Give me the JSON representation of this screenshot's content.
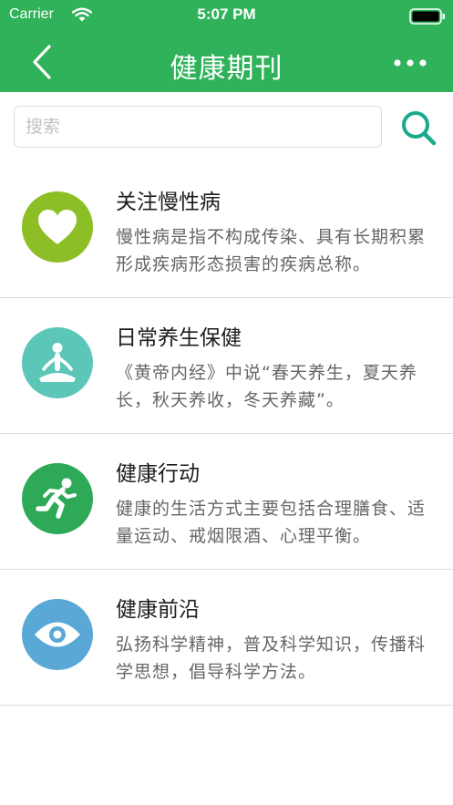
{
  "status_bar": {
    "carrier": "Carrier",
    "time": "5:07 PM"
  },
  "nav": {
    "title": "健康期刊",
    "back_icon": "chevron-left-icon",
    "more_icon": "more-dots-icon"
  },
  "search": {
    "placeholder": "搜索",
    "value": "",
    "icon": "search-icon"
  },
  "colors": {
    "header": "#2fb25a",
    "search_icon": "#1aaa8c"
  },
  "items": [
    {
      "title": "关注慢性病",
      "description": "慢性病是指不构成传染、具有长期积累形成疾病形态损害的疾病总称。",
      "icon": "heart-icon",
      "icon_color": "#8cbf26"
    },
    {
      "title": "日常养生保健",
      "description": "《黄帝内经》中说“春天养生，夏天养长，秋天养收，冬天养藏”。",
      "icon": "meditation-icon",
      "icon_color": "#5cc7b9"
    },
    {
      "title": "健康行动",
      "description": "健康的生活方式主要包括合理膳食、适量运动、戒烟限酒、心理平衡。",
      "icon": "running-icon",
      "icon_color": "#2ea957"
    },
    {
      "title": "健康前沿",
      "description": "弘扬科学精神，普及科学知识，传播科学思想，倡导科学方法。",
      "icon": "eye-icon",
      "icon_color": "#5aa8d6"
    }
  ]
}
